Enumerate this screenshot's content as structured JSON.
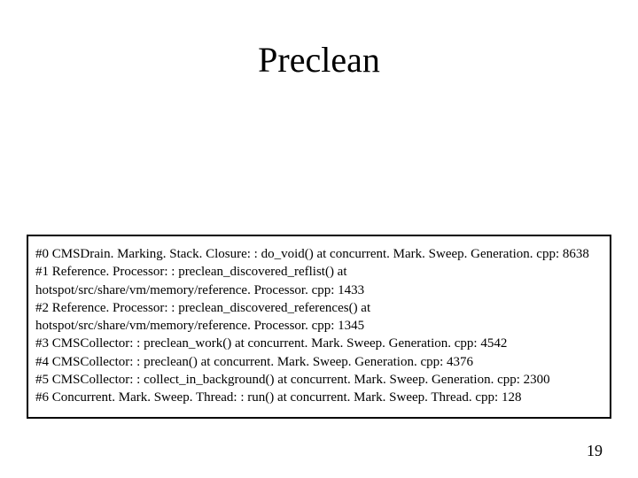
{
  "title": "Preclean",
  "trace": {
    "lines": [
      "#0  CMSDrain. Marking. Stack. Closure: : do_void() at concurrent. Mark. Sweep. Generation. cpp: 8638",
      "#1  Reference. Processor: : preclean_discovered_reflist() at",
      "hotspot/src/share/vm/memory/reference. Processor. cpp: 1433",
      "#2  Reference. Processor: : preclean_discovered_references() at",
      "hotspot/src/share/vm/memory/reference. Processor. cpp: 1345",
      "#3  CMSCollector: : preclean_work() at concurrent. Mark. Sweep. Generation. cpp: 4542",
      "#4  CMSCollector: : preclean() at concurrent. Mark. Sweep. Generation. cpp: 4376",
      "#5  CMSCollector: : collect_in_background() at concurrent. Mark. Sweep. Generation. cpp: 2300",
      "#6  Concurrent. Mark. Sweep. Thread: : run() at concurrent. Mark. Sweep. Thread. cpp: 128"
    ]
  },
  "page_number": "19"
}
